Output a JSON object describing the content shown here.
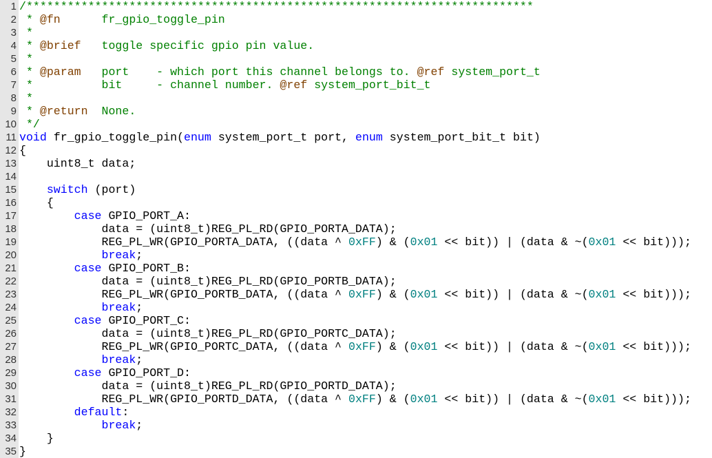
{
  "editor": {
    "language": "C",
    "lines": [
      {
        "n": "1",
        "tokens": [
          [
            "comment",
            "/**************************************************************************"
          ]
        ]
      },
      {
        "n": "2",
        "tokens": [
          [
            "comment",
            " * "
          ],
          [
            "tag",
            "@fn"
          ],
          [
            "comment",
            "      fr_gpio_toggle_pin"
          ]
        ]
      },
      {
        "n": "3",
        "tokens": [
          [
            "comment",
            " *"
          ]
        ]
      },
      {
        "n": "4",
        "tokens": [
          [
            "comment",
            " * "
          ],
          [
            "tag",
            "@brief"
          ],
          [
            "comment",
            "   toggle specific gpio pin value."
          ]
        ]
      },
      {
        "n": "5",
        "tokens": [
          [
            "comment",
            " *"
          ]
        ]
      },
      {
        "n": "6",
        "tokens": [
          [
            "comment",
            " * "
          ],
          [
            "tag",
            "@param"
          ],
          [
            "comment",
            "   port    - which port this channel belongs to. "
          ],
          [
            "tag",
            "@ref"
          ],
          [
            "comment",
            " system_port_t"
          ]
        ]
      },
      {
        "n": "7",
        "tokens": [
          [
            "comment",
            " *          bit     - channel number. "
          ],
          [
            "tag",
            "@ref"
          ],
          [
            "comment",
            " system_port_bit_t"
          ]
        ]
      },
      {
        "n": "8",
        "tokens": [
          [
            "comment",
            " *"
          ]
        ]
      },
      {
        "n": "9",
        "tokens": [
          [
            "comment",
            " * "
          ],
          [
            "tag",
            "@return"
          ],
          [
            "comment",
            "  None."
          ]
        ]
      },
      {
        "n": "10",
        "tokens": [
          [
            "comment",
            " */"
          ]
        ]
      },
      {
        "n": "11",
        "tokens": [
          [
            "keyword",
            "void"
          ],
          [
            "plain",
            " fr_gpio_toggle_pin("
          ],
          [
            "keyword",
            "enum"
          ],
          [
            "plain",
            " system_port_t port, "
          ],
          [
            "keyword",
            "enum"
          ],
          [
            "plain",
            " system_port_bit_t bit)"
          ]
        ]
      },
      {
        "n": "12",
        "tokens": [
          [
            "brace",
            "{"
          ]
        ]
      },
      {
        "n": "13",
        "tokens": [
          [
            "plain",
            "    uint8_t data;"
          ]
        ]
      },
      {
        "n": "14",
        "tokens": []
      },
      {
        "n": "15",
        "tokens": [
          [
            "plain",
            "    "
          ],
          [
            "keyword",
            "switch"
          ],
          [
            "plain",
            " (port)"
          ]
        ]
      },
      {
        "n": "16",
        "tokens": [
          [
            "plain",
            "    {"
          ]
        ]
      },
      {
        "n": "17",
        "tokens": [
          [
            "plain",
            "        "
          ],
          [
            "keyword",
            "case"
          ],
          [
            "plain",
            " GPIO_PORT_A:"
          ]
        ]
      },
      {
        "n": "18",
        "tokens": [
          [
            "plain",
            "            data = (uint8_t)REG_PL_RD(GPIO_PORTA_DATA);"
          ]
        ]
      },
      {
        "n": "19",
        "tokens": [
          [
            "plain",
            "            REG_PL_WR(GPIO_PORTA_DATA, ((data ^ "
          ],
          [
            "number",
            "0xFF"
          ],
          [
            "plain",
            ") & ("
          ],
          [
            "number",
            "0x01"
          ],
          [
            "plain",
            " << bit)) | (data & ~("
          ],
          [
            "number",
            "0x01"
          ],
          [
            "plain",
            " << bit)));"
          ]
        ]
      },
      {
        "n": "20",
        "tokens": [
          [
            "plain",
            "            "
          ],
          [
            "keyword",
            "break"
          ],
          [
            "plain",
            ";"
          ]
        ]
      },
      {
        "n": "21",
        "tokens": [
          [
            "plain",
            "        "
          ],
          [
            "keyword",
            "case"
          ],
          [
            "plain",
            " GPIO_PORT_B:"
          ]
        ]
      },
      {
        "n": "22",
        "tokens": [
          [
            "plain",
            "            data = (uint8_t)REG_PL_RD(GPIO_PORTB_DATA);"
          ]
        ]
      },
      {
        "n": "23",
        "tokens": [
          [
            "plain",
            "            REG_PL_WR(GPIO_PORTB_DATA, ((data ^ "
          ],
          [
            "number",
            "0xFF"
          ],
          [
            "plain",
            ") & ("
          ],
          [
            "number",
            "0x01"
          ],
          [
            "plain",
            " << bit)) | (data & ~("
          ],
          [
            "number",
            "0x01"
          ],
          [
            "plain",
            " << bit)));"
          ]
        ]
      },
      {
        "n": "24",
        "tokens": [
          [
            "plain",
            "            "
          ],
          [
            "keyword",
            "break"
          ],
          [
            "plain",
            ";"
          ]
        ]
      },
      {
        "n": "25",
        "tokens": [
          [
            "plain",
            "        "
          ],
          [
            "keyword",
            "case"
          ],
          [
            "plain",
            " GPIO_PORT_C:"
          ]
        ]
      },
      {
        "n": "26",
        "tokens": [
          [
            "plain",
            "            data = (uint8_t)REG_PL_RD(GPIO_PORTC_DATA);"
          ]
        ]
      },
      {
        "n": "27",
        "tokens": [
          [
            "plain",
            "            REG_PL_WR(GPIO_PORTC_DATA, ((data ^ "
          ],
          [
            "number",
            "0xFF"
          ],
          [
            "plain",
            ") & ("
          ],
          [
            "number",
            "0x01"
          ],
          [
            "plain",
            " << bit)) | (data & ~("
          ],
          [
            "number",
            "0x01"
          ],
          [
            "plain",
            " << bit)));"
          ]
        ]
      },
      {
        "n": "28",
        "tokens": [
          [
            "plain",
            "            "
          ],
          [
            "keyword",
            "break"
          ],
          [
            "plain",
            ";"
          ]
        ]
      },
      {
        "n": "29",
        "tokens": [
          [
            "plain",
            "        "
          ],
          [
            "keyword",
            "case"
          ],
          [
            "plain",
            " GPIO_PORT_D:"
          ]
        ]
      },
      {
        "n": "30",
        "tokens": [
          [
            "plain",
            "            data = (uint8_t)REG_PL_RD(GPIO_PORTD_DATA);"
          ]
        ]
      },
      {
        "n": "31",
        "tokens": [
          [
            "plain",
            "            REG_PL_WR(GPIO_PORTD_DATA, ((data ^ "
          ],
          [
            "number",
            "0xFF"
          ],
          [
            "plain",
            ") & ("
          ],
          [
            "number",
            "0x01"
          ],
          [
            "plain",
            " << bit)) | (data & ~("
          ],
          [
            "number",
            "0x01"
          ],
          [
            "plain",
            " << bit)));"
          ]
        ]
      },
      {
        "n": "32",
        "tokens": [
          [
            "plain",
            "        "
          ],
          [
            "keyword",
            "default"
          ],
          [
            "plain",
            ":"
          ]
        ]
      },
      {
        "n": "33",
        "tokens": [
          [
            "plain",
            "            "
          ],
          [
            "keyword",
            "break"
          ],
          [
            "plain",
            ";"
          ]
        ]
      },
      {
        "n": "34",
        "tokens": [
          [
            "plain",
            "    }"
          ]
        ]
      },
      {
        "n": "35",
        "tokens": [
          [
            "brace",
            "}"
          ]
        ]
      }
    ]
  }
}
